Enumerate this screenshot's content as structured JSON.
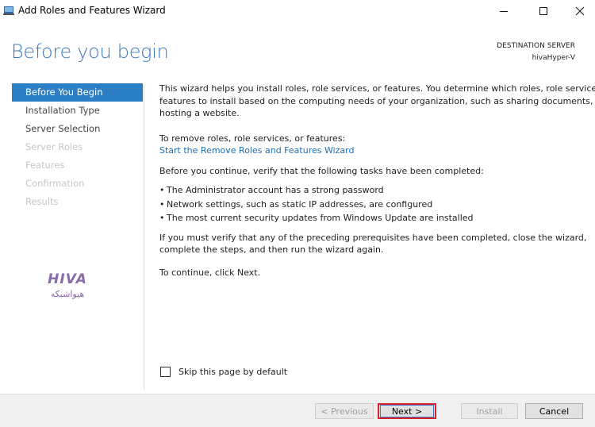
{
  "window": {
    "title": "Add Roles and Features Wizard"
  },
  "header": {
    "page_title": "Before you begin",
    "destination_label": "DESTINATION SERVER",
    "destination_server": "hivaHyper-V"
  },
  "nav": {
    "items": [
      {
        "label": "Before You Begin",
        "state": "active"
      },
      {
        "label": "Installation Type",
        "state": "enabled"
      },
      {
        "label": "Server Selection",
        "state": "enabled"
      },
      {
        "label": "Server Roles",
        "state": "disabled"
      },
      {
        "label": "Features",
        "state": "disabled"
      },
      {
        "label": "Confirmation",
        "state": "disabled"
      },
      {
        "label": "Results",
        "state": "disabled"
      }
    ]
  },
  "logo": {
    "text": "HIVA",
    "subtitle": "هیواشبکه",
    "color": "#8a6aa8"
  },
  "content": {
    "intro_line1": "This wizard helps you install roles, role services, or features. You determine which roles, role services, or",
    "intro_line2": "features to install based on the computing needs of your organization, such as sharing documents, or",
    "intro_line3": "hosting a website.",
    "remove_text": "To remove roles, role services, or features:",
    "remove_link": "Start the Remove Roles and Features Wizard",
    "verify_text": "Before you continue, verify that the following tasks have been completed:",
    "bullets": [
      "The Administrator account has a strong password",
      "Network settings, such as static IP addresses, are configured",
      "The most current security updates from Windows Update are installed"
    ],
    "prereq_line1": "If you must verify that any of the preceding prerequisites have been completed, close the wizard,",
    "prereq_line2": "complete the steps, and then run the wizard again.",
    "continue_text": "To continue, click Next."
  },
  "skip_checkbox": {
    "label": "Skip this page by default",
    "checked": false
  },
  "buttons": {
    "previous": "< Previous",
    "next": "Next >",
    "install": "Install",
    "cancel": "Cancel"
  },
  "colors": {
    "accent": "#2c7fc4",
    "title_blue": "#3a7bbf",
    "link": "#1f6fb5",
    "highlight_red": "#d8232a"
  }
}
